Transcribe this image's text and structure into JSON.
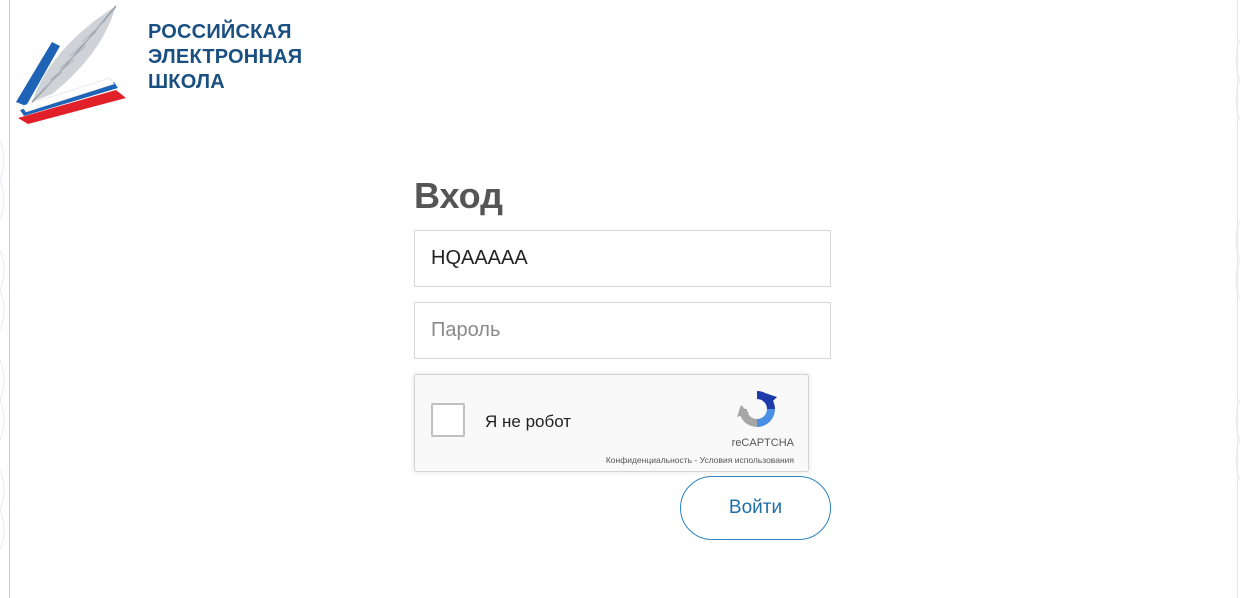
{
  "brand": {
    "line1": "РОССИЙСКАЯ",
    "line2": "ЭЛЕКТРОННАЯ",
    "line3": "ШКОЛА"
  },
  "login": {
    "title": "Вход",
    "login_value": "HQAAAAA",
    "password_placeholder": "Пароль",
    "submit_label": "Войти"
  },
  "recaptcha": {
    "label": "Я не робот",
    "brand": "reCAPTCHA",
    "privacy_link": "Конфиденциальность",
    "separator": " - ",
    "terms_link": "Условия использования",
    "checked": false
  },
  "colors": {
    "brand": "#1a4f82",
    "accent": "#2a85c2",
    "logo_red": "#e2202a",
    "logo_blue": "#1e63b6"
  },
  "icons": [
    "logo-feather-icon",
    "recaptcha-logo-icon"
  ]
}
